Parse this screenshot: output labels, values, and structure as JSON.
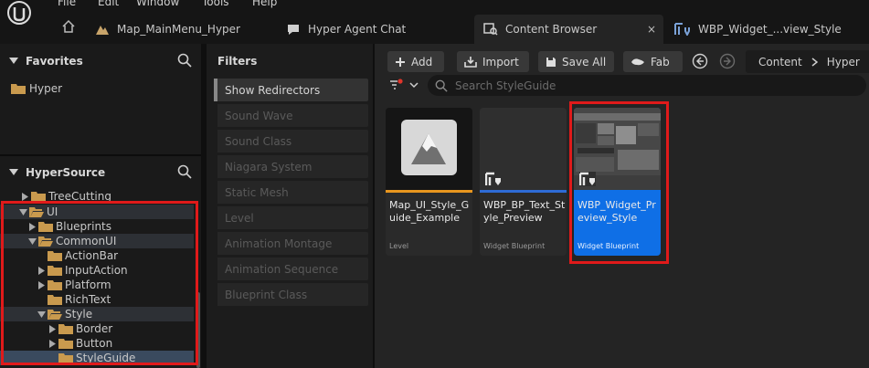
{
  "menu": {
    "items": [
      "File",
      "Edit",
      "Window",
      "Tools",
      "Help"
    ]
  },
  "tabs": [
    {
      "label": "Map_MainMenu_Hyper"
    },
    {
      "label": "Hyper Agent Chat"
    },
    {
      "label": "Content Browser",
      "close": "×"
    },
    {
      "label": "WBP_Widget_...view_Style"
    }
  ],
  "favorites": {
    "title": "Favorites",
    "items": [
      "Hyper"
    ]
  },
  "hypersource": {
    "title": "HyperSource",
    "tree": [
      {
        "label": "TreeCutting"
      },
      {
        "label": "UI"
      },
      {
        "label": "Blueprints"
      },
      {
        "label": "CommonUI"
      },
      {
        "label": "ActionBar"
      },
      {
        "label": "InputAction"
      },
      {
        "label": "Platform"
      },
      {
        "label": "RichText"
      },
      {
        "label": "Style"
      },
      {
        "label": "Border"
      },
      {
        "label": "Button"
      },
      {
        "label": "StyleGuide"
      }
    ]
  },
  "filters": {
    "title": "Filters",
    "items": [
      "Show Redirectors",
      "Sound Wave",
      "Sound Class",
      "Niagara System",
      "Static Mesh",
      "Level",
      "Animation Montage",
      "Animation Sequence",
      "Blueprint Class"
    ]
  },
  "toolbar": {
    "add": "Add",
    "import": "Import",
    "save_all": "Save All",
    "fab": "Fab"
  },
  "breadcrumb": [
    "Content",
    "Hyper"
  ],
  "search": {
    "placeholder": "Search StyleGuide",
    "value": ""
  },
  "assets": [
    {
      "name": "Map_UI_Style_Guide_Example",
      "type": "Level",
      "color": "#e8961e"
    },
    {
      "name": "WBP_BP_Text_Style_Preview",
      "type": "Widget Blueprint",
      "color": "#2e6bd6"
    },
    {
      "name": "WBP_Widget_Preview_Style",
      "type": "Widget Blueprint",
      "color": "#0f6fe6"
    }
  ],
  "colors": {
    "highlight": "#e01a1a",
    "selection": "#0f6fe6",
    "folder": "#c99a4e"
  }
}
